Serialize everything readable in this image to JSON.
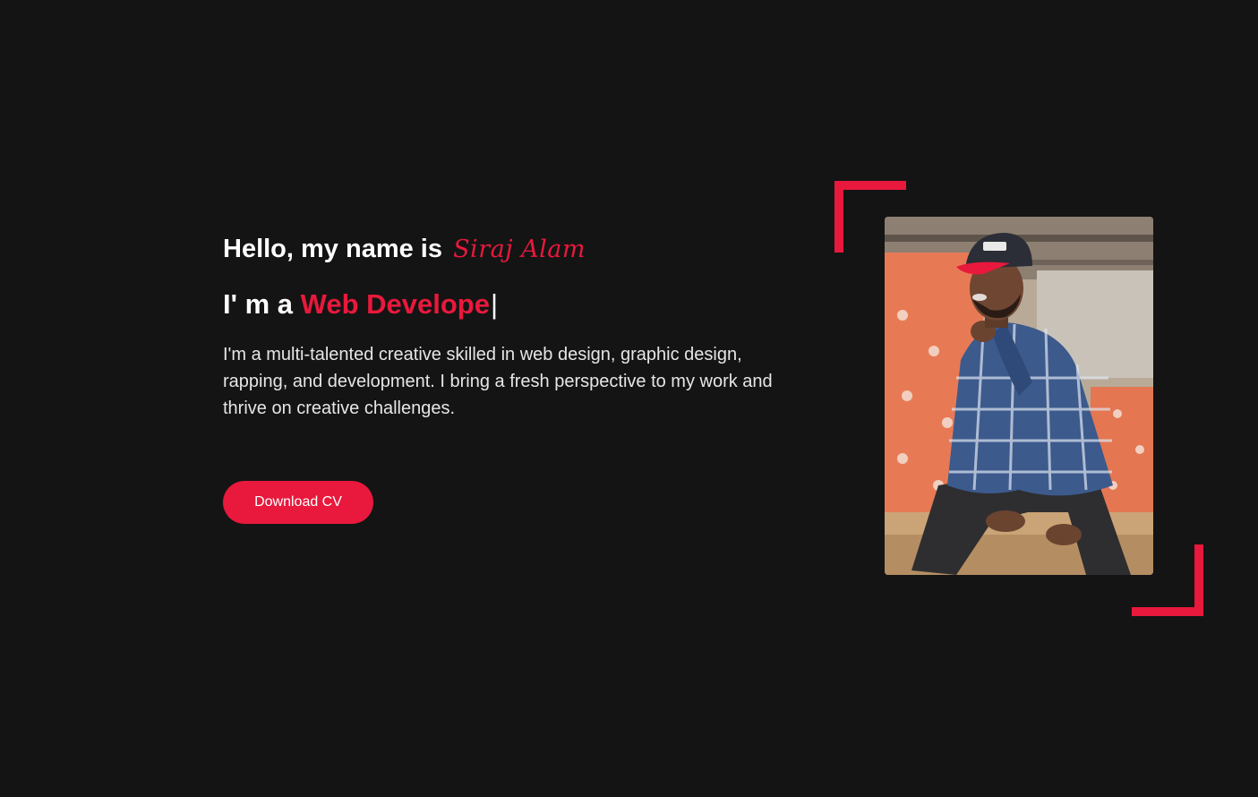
{
  "hero": {
    "greeting_prefix": "Hello, my name is",
    "name": "Siraj Alam",
    "role_prefix": "I' m a",
    "role": "Web Develope",
    "cursor": "|",
    "bio": "I'm a multi-talented creative skilled in web design, graphic design, rapping, and development. I bring a fresh perspective to my work and thrive on creative challenges.",
    "cta_label": "Download CV"
  },
  "profile_photo": {
    "subject": "man in cap and checkered shirt seated outdoors"
  },
  "colors": {
    "background": "#141414",
    "accent": "#e8193c",
    "text": "#ffffff",
    "muted_text": "#e6e6e6"
  }
}
